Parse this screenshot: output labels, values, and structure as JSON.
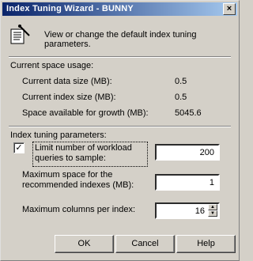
{
  "window": {
    "title": "Index Tuning Wizard - BUNNY",
    "close_glyph": "×"
  },
  "intro": {
    "text": "View or change the default index tuning parameters."
  },
  "current_space": {
    "heading": "Current space usage:",
    "rows": [
      {
        "label": "Current data size (MB):",
        "value": "0.5"
      },
      {
        "label": "Current index size (MB):",
        "value": "0.5"
      },
      {
        "label": "Space available for growth (MB):",
        "value": "5045.6"
      }
    ]
  },
  "parameters": {
    "heading": "Index tuning parameters:",
    "limit_queries": {
      "label": "Limit number of workload queries to sample:",
      "checked": true,
      "value": "200"
    },
    "max_space": {
      "label": "Maximum space for the recommended indexes (MB):",
      "value": "1"
    },
    "max_columns": {
      "label": "Maximum columns per index:",
      "value": "16"
    }
  },
  "buttons": {
    "ok": "OK",
    "cancel": "Cancel",
    "help": "Help"
  }
}
